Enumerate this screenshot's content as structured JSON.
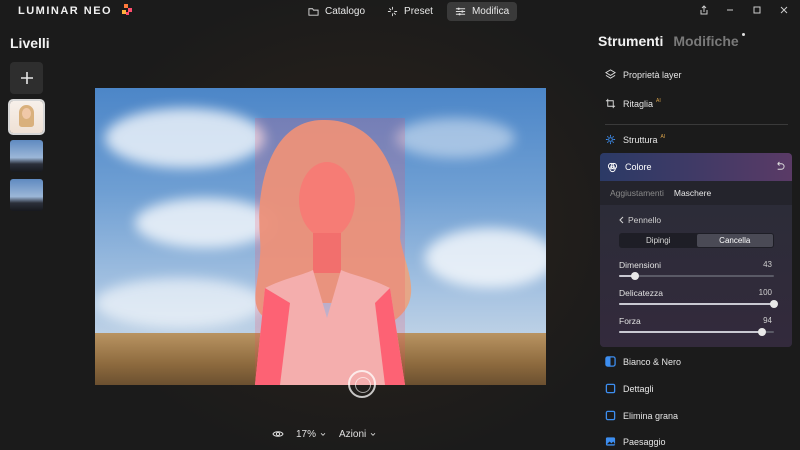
{
  "app": {
    "logo_text": "LUMINAR NEO"
  },
  "nav": {
    "tabs": [
      {
        "label": "Catalogo",
        "icon": "folder-icon"
      },
      {
        "label": "Preset",
        "icon": "sparkle-icon"
      },
      {
        "label": "Modifica",
        "icon": "sliders-icon",
        "active": true
      }
    ]
  },
  "window": {
    "controls": [
      "share-icon",
      "minimize-icon",
      "maximize-icon",
      "close-icon"
    ]
  },
  "layers": {
    "title": "Livelli",
    "items": [
      {
        "name": "portrait",
        "selected": true
      },
      {
        "name": "sky-1",
        "selected": false
      },
      {
        "name": "sky-2",
        "selected": false
      }
    ]
  },
  "bottom_bar": {
    "zoom": "17%",
    "actions_label": "Azioni"
  },
  "panel": {
    "tab_tools": "Strumenti",
    "tab_edits": "Modifiche",
    "tools_top": [
      {
        "label": "Proprietà layer",
        "icon": "layers-icon"
      },
      {
        "label": "Ritaglia",
        "icon": "crop-icon",
        "ai": "AI"
      },
      {
        "label": "Struttura",
        "icon": "structure-icon",
        "ai": "AI"
      }
    ],
    "color_tool": {
      "label": "Colore",
      "subtabs": [
        "Aggiustamenti",
        "Maschere"
      ],
      "back_label": "Pennello",
      "mode_paint": "Dipingi",
      "mode_erase": "Cancella",
      "active_mode": "Cancella",
      "sliders": [
        {
          "label": "Dimensioni",
          "value": 43,
          "fraction": 0.1
        },
        {
          "label": "Delicatezza",
          "value": 100,
          "fraction": 1.0
        },
        {
          "label": "Forza",
          "value": 94,
          "fraction": 0.92
        }
      ]
    },
    "tools_bottom": [
      {
        "label": "Bianco & Nero"
      },
      {
        "label": "Dettagli"
      },
      {
        "label": "Elimina grana"
      },
      {
        "label": "Paesaggio"
      }
    ]
  },
  "colors": {
    "accent_blue": "#3d8ef0",
    "mask_overlay": "#ff3c5a",
    "ai_badge": "#d9a24a"
  }
}
